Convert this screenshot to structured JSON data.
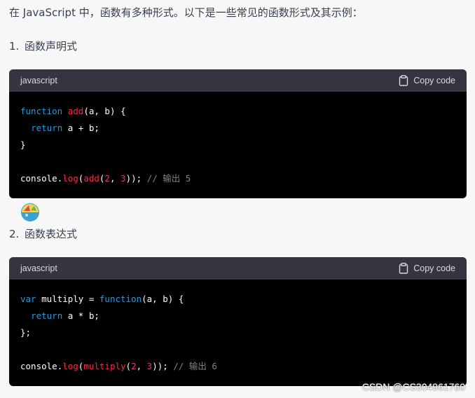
{
  "intro": "在 JavaScript 中，函数有多种形式。以下是一些常见的函数形式及其示例：",
  "items": [
    {
      "number": "1.",
      "title": "函数声明式",
      "language": "javascript",
      "copy_label": "Copy code",
      "code": {
        "l1_kw": "function",
        "l1_fn": "add",
        "l1_rest": "(a, b) {",
        "l2_indent": "  ",
        "l2_kw": "return",
        "l2_rest": " a + b;",
        "l3": "}",
        "l5_obj": "console",
        "l5_dot": ".",
        "l5_fn": "log",
        "l5_p1": "(",
        "l5_fn2": "add",
        "l5_p2": "(",
        "l5_n1": "2",
        "l5_sep": ", ",
        "l5_n2": "3",
        "l5_close": "));",
        "l5_comment": " // 输出 5"
      }
    },
    {
      "number": "2.",
      "title": "函数表达式",
      "language": "javascript",
      "copy_label": "Copy code",
      "code": {
        "l1_kw": "var",
        "l1_mid": " multiply = ",
        "l1_kw2": "function",
        "l1_rest": "(a, b) {",
        "l2_indent": "  ",
        "l2_kw": "return",
        "l2_rest": " a * b;",
        "l3": "};",
        "l5_obj": "console",
        "l5_dot": ".",
        "l5_fn": "log",
        "l5_p1": "(",
        "l5_fn2": "multiply",
        "l5_p2": "(",
        "l5_n1": "2",
        "l5_sep": ", ",
        "l5_n2": "3",
        "l5_close": "));",
        "l5_comment": " // 输出 6"
      }
    }
  ],
  "watermark": "CSDN @CS304961760",
  "colors": {
    "keyword": "#2e95d3",
    "function": "#f22c3d",
    "number": "#df3079",
    "header_bg": "#343541",
    "code_bg": "#000000"
  }
}
